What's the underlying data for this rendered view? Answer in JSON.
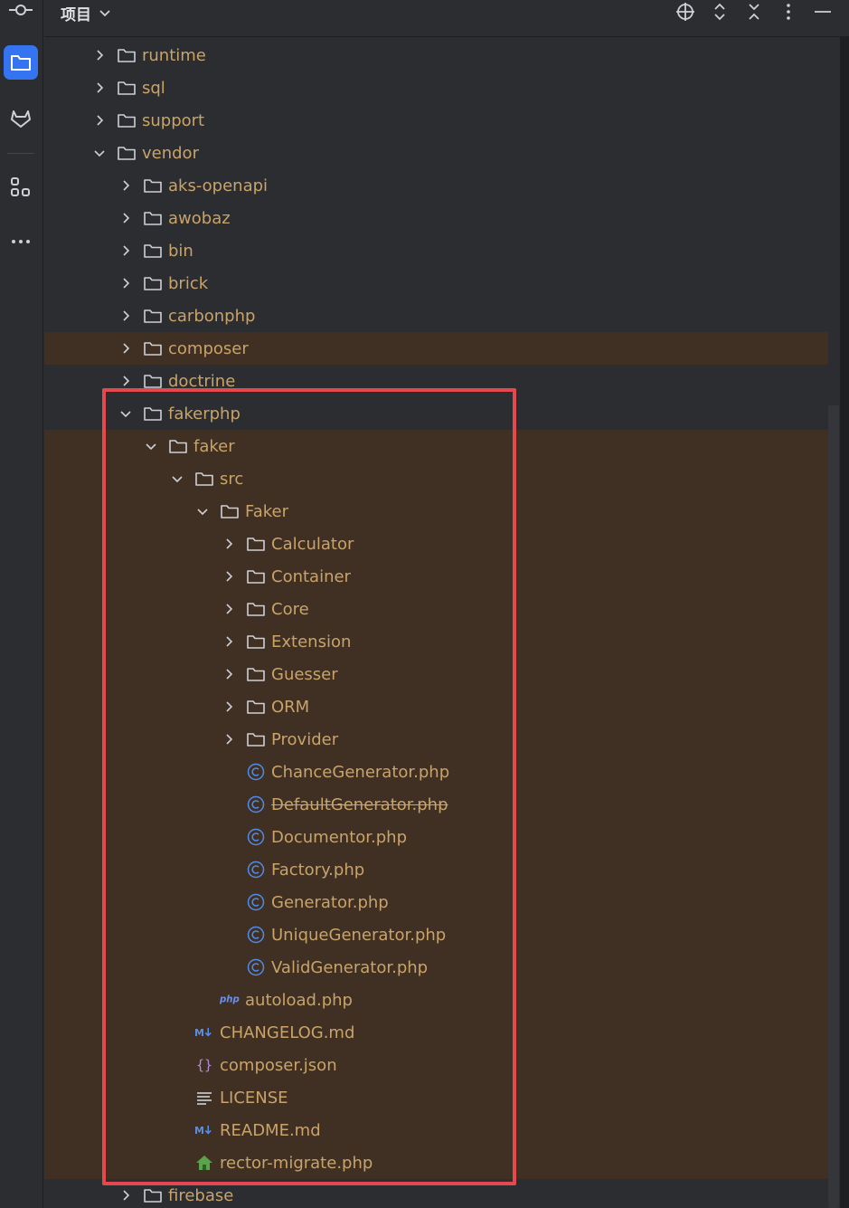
{
  "panel": {
    "title": "项目"
  },
  "activity_bar": {
    "items": [
      {
        "icon": "commit-icon"
      },
      {
        "icon": "folder-icon",
        "active": true
      },
      {
        "icon": "gitlab-icon"
      },
      {
        "icon": "structure-icon"
      },
      {
        "icon": "more-icon"
      }
    ]
  },
  "toolbar": {
    "icons": [
      "locate-icon",
      "expand-all-icon",
      "collapse-all-icon",
      "options-icon",
      "minimize-icon"
    ]
  },
  "colors": {
    "background": "#2b2d30",
    "highlight_row": "#3f3023",
    "file_text": "#c9a36a",
    "focus_box": "#e5484d",
    "accent": "#3574f0"
  },
  "tree": {
    "items": [
      {
        "name": "runtime",
        "type": "folder",
        "depth": 0,
        "expanded": false
      },
      {
        "name": "sql",
        "type": "folder",
        "depth": 0,
        "expanded": false
      },
      {
        "name": "support",
        "type": "folder",
        "depth": 0,
        "expanded": false
      },
      {
        "name": "vendor",
        "type": "folder",
        "depth": 0,
        "expanded": true
      },
      {
        "name": "aks-openapi",
        "type": "folder",
        "depth": 1,
        "expanded": false
      },
      {
        "name": "awobaz",
        "type": "folder",
        "depth": 1,
        "expanded": false
      },
      {
        "name": "bin",
        "type": "folder",
        "depth": 1,
        "expanded": false
      },
      {
        "name": "brick",
        "type": "folder",
        "depth": 1,
        "expanded": false
      },
      {
        "name": "carbonphp",
        "type": "folder",
        "depth": 1,
        "expanded": false
      },
      {
        "name": "composer",
        "type": "folder",
        "depth": 1,
        "expanded": false,
        "highlighted": true
      },
      {
        "name": "doctrine",
        "type": "folder",
        "depth": 1,
        "expanded": false
      },
      {
        "name": "fakerphp",
        "type": "folder",
        "depth": 1,
        "expanded": true
      },
      {
        "name": "faker",
        "type": "folder",
        "depth": 2,
        "expanded": true,
        "highlighted": true
      },
      {
        "name": "src",
        "type": "folder",
        "depth": 3,
        "expanded": true,
        "highlighted": true
      },
      {
        "name": "Faker",
        "type": "folder",
        "depth": 4,
        "expanded": true,
        "highlighted": true
      },
      {
        "name": "Calculator",
        "type": "folder",
        "depth": 5,
        "expanded": false,
        "highlighted": true
      },
      {
        "name": "Container",
        "type": "folder",
        "depth": 5,
        "expanded": false,
        "highlighted": true
      },
      {
        "name": "Core",
        "type": "folder",
        "depth": 5,
        "expanded": false,
        "highlighted": true
      },
      {
        "name": "Extension",
        "type": "folder",
        "depth": 5,
        "expanded": false,
        "highlighted": true
      },
      {
        "name": "Guesser",
        "type": "folder",
        "depth": 5,
        "expanded": false,
        "highlighted": true
      },
      {
        "name": "ORM",
        "type": "folder",
        "depth": 5,
        "expanded": false,
        "highlighted": true
      },
      {
        "name": "Provider",
        "type": "folder",
        "depth": 5,
        "expanded": false,
        "highlighted": true
      },
      {
        "name": "ChanceGenerator.php",
        "type": "class",
        "depth": 5,
        "highlighted": true
      },
      {
        "name": "DefaultGenerator.php",
        "type": "class",
        "depth": 5,
        "highlighted": true,
        "deprecated": true
      },
      {
        "name": "Documentor.php",
        "type": "class",
        "depth": 5,
        "highlighted": true
      },
      {
        "name": "Factory.php",
        "type": "class",
        "depth": 5,
        "highlighted": true
      },
      {
        "name": "Generator.php",
        "type": "class",
        "depth": 5,
        "highlighted": true
      },
      {
        "name": "UniqueGenerator.php",
        "type": "class",
        "depth": 5,
        "highlighted": true
      },
      {
        "name": "ValidGenerator.php",
        "type": "class",
        "depth": 5,
        "highlighted": true
      },
      {
        "name": "autoload.php",
        "type": "php",
        "depth": 4,
        "highlighted": true
      },
      {
        "name": "CHANGELOG.md",
        "type": "markdown",
        "depth": 3,
        "highlighted": true
      },
      {
        "name": "composer.json",
        "type": "json",
        "depth": 3,
        "highlighted": true
      },
      {
        "name": "LICENSE",
        "type": "text",
        "depth": 3,
        "highlighted": true
      },
      {
        "name": "README.md",
        "type": "markdown",
        "depth": 3,
        "highlighted": true
      },
      {
        "name": "rector-migrate.php",
        "type": "rector",
        "depth": 3,
        "highlighted": true
      },
      {
        "name": "firebase",
        "type": "folder",
        "depth": 1,
        "expanded": false
      }
    ]
  }
}
